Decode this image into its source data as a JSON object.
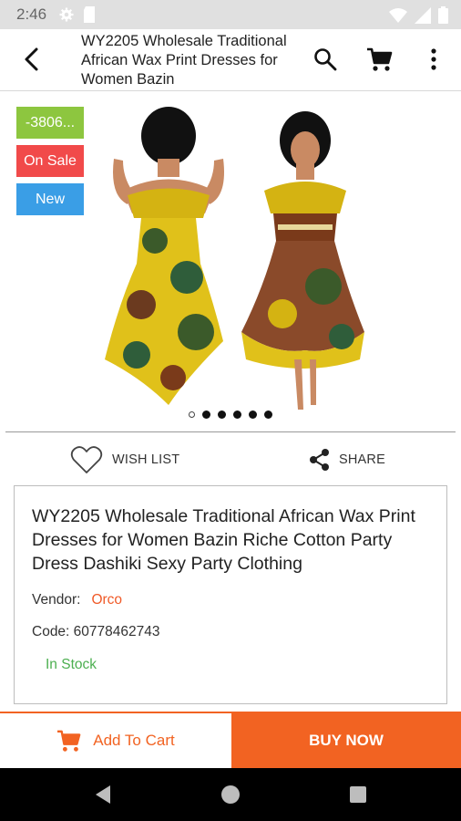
{
  "status_bar": {
    "time": "2:46",
    "icons_left": [
      "settings-icon",
      "sd-card-icon"
    ],
    "icons_right": [
      "wifi-icon",
      "signal-icon",
      "battery-icon"
    ]
  },
  "app_bar": {
    "title": "WY2205 Wholesale Traditional African Wax Print Dresses for Women Bazin",
    "icons": [
      "back-arrow-icon",
      "search-icon",
      "cart-icon",
      "more-vert-icon"
    ]
  },
  "gallery": {
    "badges": {
      "discount": "-3806...",
      "sale": "On Sale",
      "new": "New"
    },
    "image_count": 6,
    "active_index": 0
  },
  "actions": {
    "wishlist_label": "WISH LIST",
    "share_label": "SHARE"
  },
  "product": {
    "title": "WY2205 Wholesale Traditional African Wax Print Dresses for Women Bazin Riche Cotton Party Dress Dashiki Sexy Party Clothing",
    "vendor_label": "Vendor:",
    "vendor_name": "Orco",
    "code_text": "Code: 60778462743",
    "stock_status": "In Stock"
  },
  "bottom": {
    "add_to_cart_label": "Add To Cart",
    "buy_now_label": "BUY NOW"
  },
  "colors": {
    "accent": "#f26322",
    "badge_discount": "#8dc63f",
    "badge_sale": "#f14a4a",
    "badge_new": "#3a9ee6",
    "in_stock": "#4caf50"
  }
}
